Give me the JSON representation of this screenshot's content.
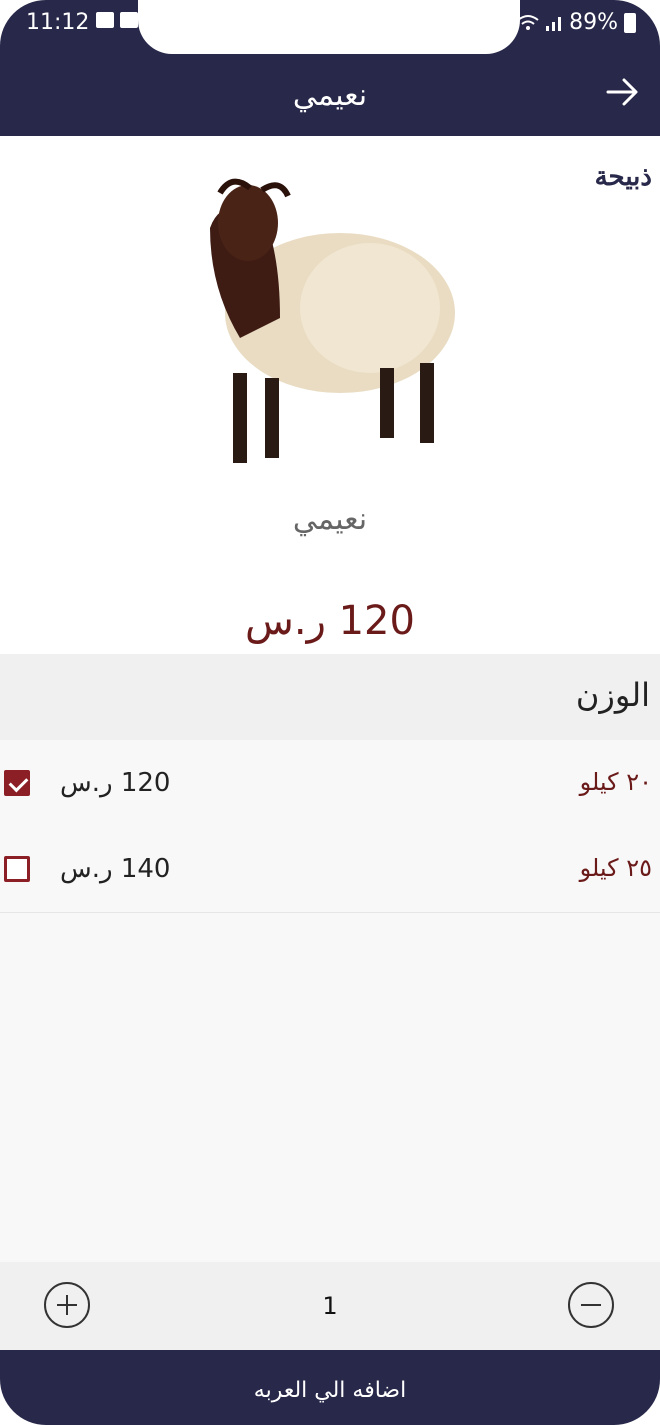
{
  "status_bar": {
    "time": "11:12",
    "battery": "89%"
  },
  "header": {
    "title": "نعيمي"
  },
  "brand": "ذبيحة",
  "product": {
    "name": "نعيمي",
    "price": "120 ر.س"
  },
  "weight": {
    "label": "الوزن",
    "options": [
      {
        "weight": "٢٠ كيلو",
        "price": "120 ر.س",
        "checked": true
      },
      {
        "weight": "٢٥ كيلو",
        "price": "140 ر.س",
        "checked": false
      }
    ]
  },
  "quantity": {
    "value": "1"
  },
  "cart_button": "اضافه الي العربه",
  "colors": {
    "primary": "#28284a",
    "accent": "#8c1f25",
    "price": "#6b1a1a"
  }
}
